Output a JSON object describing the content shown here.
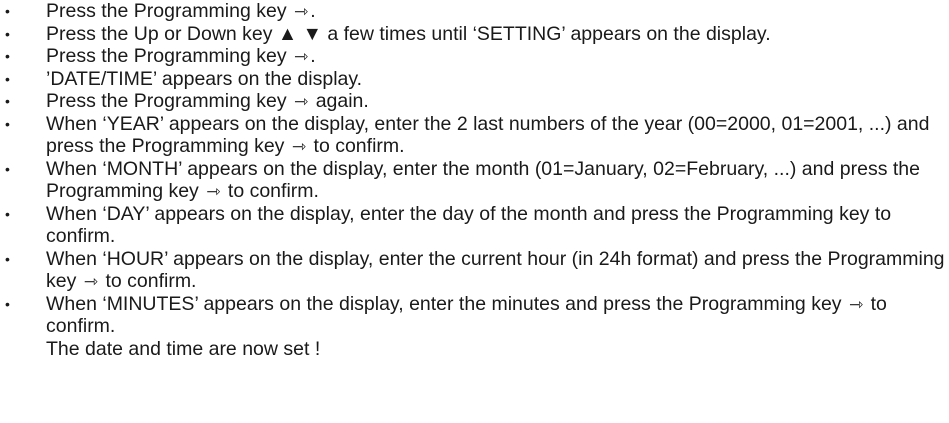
{
  "bullet_char": "•",
  "icons": {
    "programming_key": "⇾",
    "up_down": "▲ ▼"
  },
  "steps": [
    {
      "text": "Press the Programming key",
      "key": true,
      "after": "."
    },
    {
      "text": "Press the Up or Down key ▲ ▼ a few times until ‘SETTING’ appears on the display."
    },
    {
      "text": "Press the Programming key",
      "key": true,
      "after": "."
    },
    {
      "text": "’DATE/TIME’ appears on the display."
    },
    {
      "text": "Press the Programming key",
      "key": true,
      "after": "again."
    },
    {
      "text": "When ‘YEAR’ appears on the display, enter the 2 last numbers of the year (00=2000, 01=2001, ...) and press the Programming key",
      "key": true,
      "after": "to confirm."
    },
    {
      "text": "When ‘MONTH’ appears on the display, enter the month (01=January, 02=February, ...) and press the Programming key",
      "key": true,
      "after": "to confirm."
    },
    {
      "text": "When ‘DAY’ appears on the display, enter the day of the month and press the Programming key  to confirm."
    },
    {
      "text": "When ‘HOUR’ appears on the display, enter the current hour (in 24h format) and press the  Programming key",
      "key": true,
      "after": "to confirm."
    },
    {
      "text": "When ‘MINUTES’ appears on the display, enter the minutes and press the Programming key",
      "key": true,
      "after": "to confirm."
    }
  ],
  "footer": "The date and time are now set !"
}
